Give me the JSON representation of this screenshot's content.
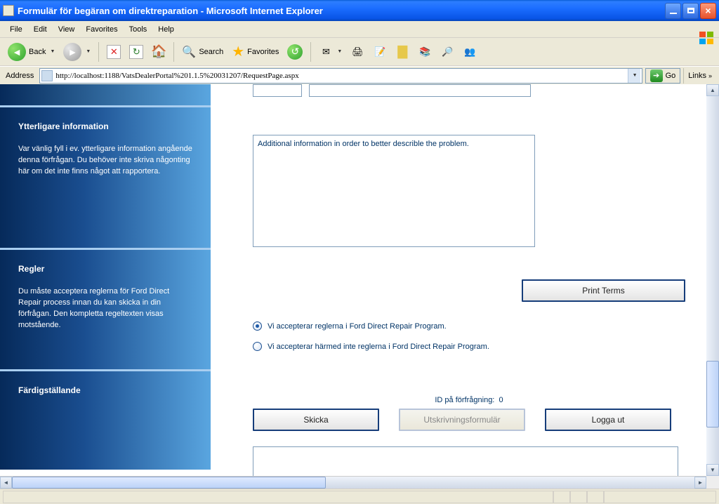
{
  "window": {
    "title": "Formulär för begäran om direktreparation - Microsoft Internet Explorer"
  },
  "menu": {
    "file": "File",
    "edit": "Edit",
    "view": "View",
    "favorites": "Favorites",
    "tools": "Tools",
    "help": "Help"
  },
  "toolbar": {
    "back": "Back",
    "search": "Search",
    "favorites": "Favorites"
  },
  "address": {
    "label": "Address",
    "url": "http://localhost:1188/VatsDealerPortal%201.1.5%20031207/RequestPage.aspx",
    "go": "Go",
    "links": "Links"
  },
  "sidebar": {
    "additional": {
      "heading": "Ytterligare information",
      "text": "Var vänlig fyll i ev. ytterligare information angående denna förfrågan. Du behöver inte skriva någonting här om det inte finns något att rapportera."
    },
    "rules": {
      "heading": "Regler",
      "text": "Du måste acceptera reglerna för Ford Direct Repair process innan du kan skicka in din förfrågan. Den kompletta regeltexten visas motstående."
    },
    "complete": {
      "heading": "Färdigställande"
    }
  },
  "main": {
    "additionalText": "Additional information in order to better describle the problem.",
    "printTerms": "Print Terms",
    "radioAccept": "Vi accepterar reglerna i Ford Direct Repair Program.",
    "radioReject": "Vi accepterar härmed inte reglerna i Ford Direct Repair Program.",
    "idLabel": "ID på förfrågning:",
    "idValue": "0",
    "skicka": "Skicka",
    "utskriv": "Utskrivningsformulär",
    "loggaut": "Logga ut"
  }
}
